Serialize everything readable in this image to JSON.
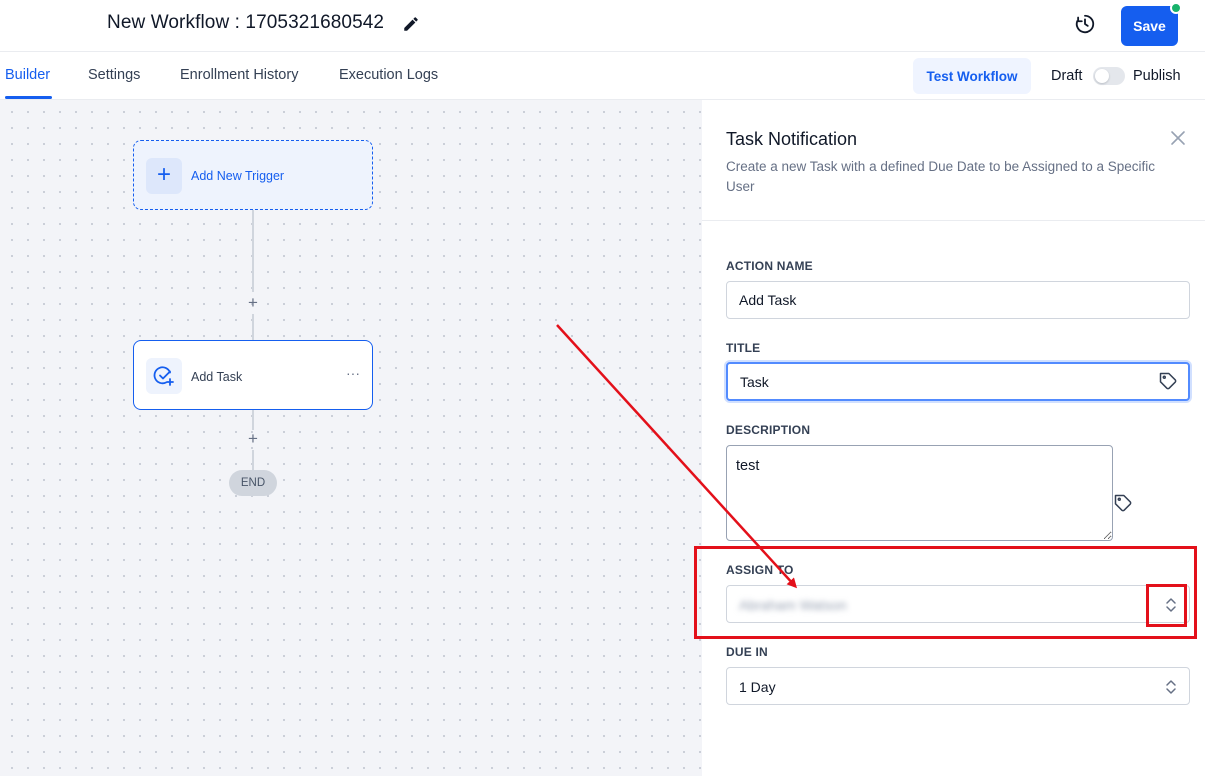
{
  "header": {
    "title": "New Workflow : 1705321680542",
    "save_label": "Save",
    "icons": {
      "edit": "pencil-icon",
      "history": "history-clock-icon"
    },
    "status_dot_color": "#17b26a",
    "accent_color": "#155eef"
  },
  "tabs": [
    {
      "label": "Builder",
      "active": true
    },
    {
      "label": "Settings",
      "active": false
    },
    {
      "label": "Enrollment History",
      "active": false
    },
    {
      "label": "Execution Logs",
      "active": false
    }
  ],
  "toolbar": {
    "test_label": "Test Workflow",
    "draft_label": "Draft",
    "publish_label": "Publish",
    "published": false
  },
  "canvas": {
    "trigger_label": "Add New Trigger",
    "task_label": "Add Task",
    "end_label": "END"
  },
  "panel": {
    "title": "Task Notification",
    "description": "Create a new Task with a defined Due Date to be Assigned to a Specific User",
    "fields": {
      "action_name": {
        "label": "ACTION NAME",
        "value": "Add Task"
      },
      "title": {
        "label": "TITLE",
        "value": "Task"
      },
      "description": {
        "label": "DESCRIPTION",
        "value": "test"
      },
      "assign_to": {
        "label": "ASSIGN TO",
        "value": "Abraham Watson"
      },
      "due_in": {
        "label": "DUE IN",
        "value": "1 Day"
      }
    }
  },
  "annotation_color": "#e3101a"
}
